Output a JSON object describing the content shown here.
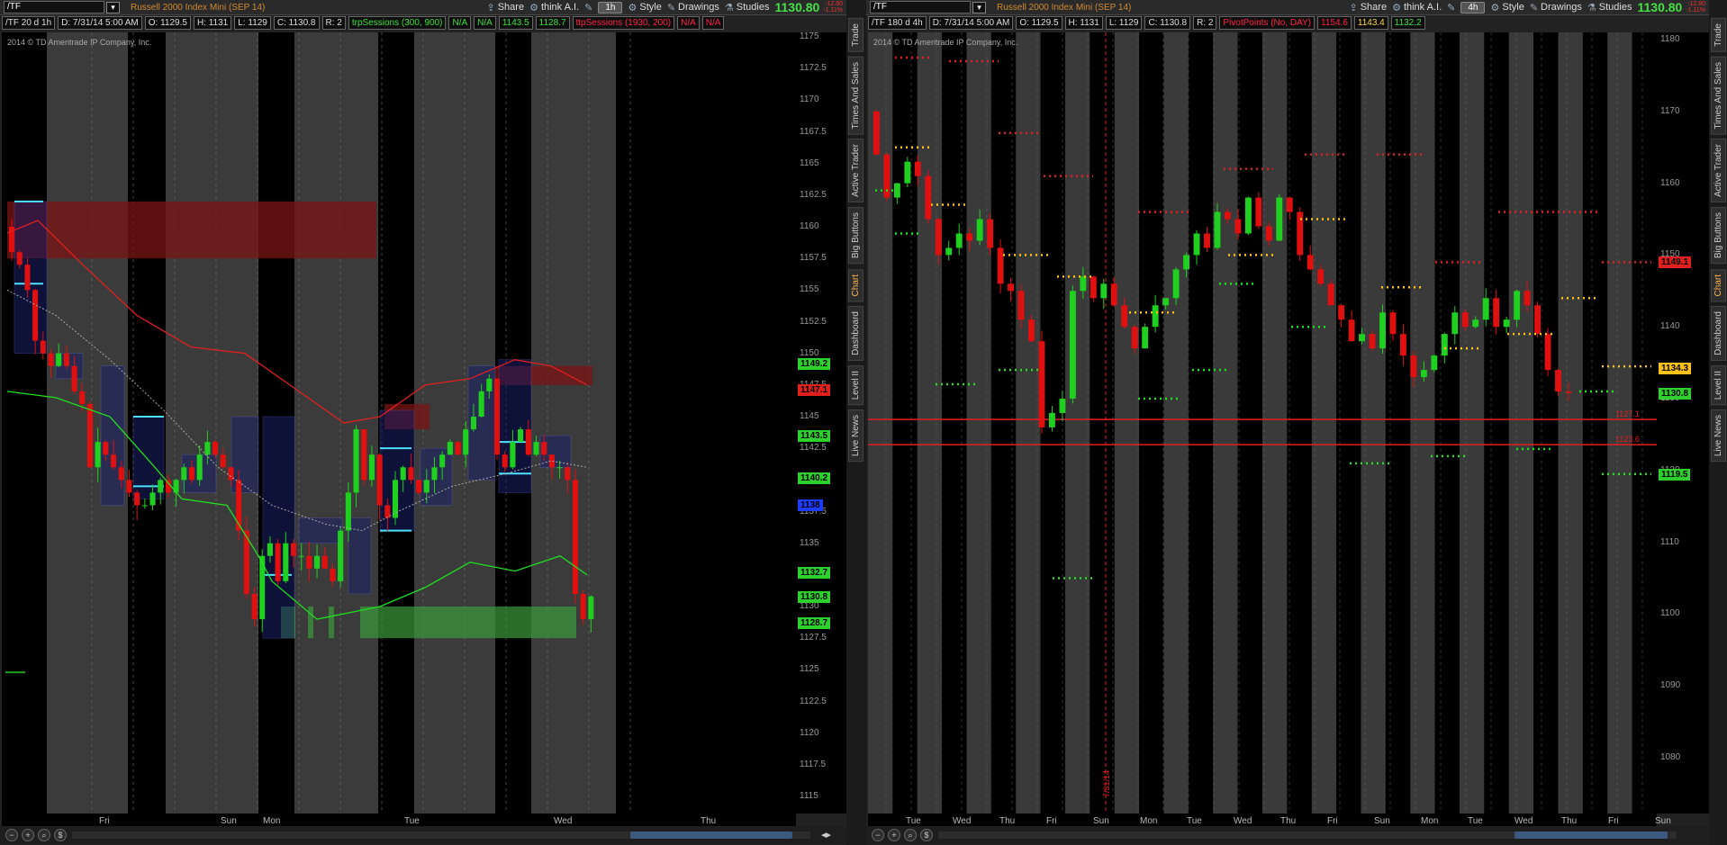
{
  "left": {
    "symbol": "/TF",
    "description": "Russell 2000 Index Mini (SEP 14)",
    "toolbar": {
      "share": "Share",
      "thinkai": "think A.I.",
      "aggregation": "1h",
      "style": "Style",
      "drawings": "Drawings",
      "studies": "Studies"
    },
    "last_price": "1130.80",
    "change1": "-12.80",
    "change2": "-1.11%",
    "info": [
      "/TF 20 d 1h",
      "D: 7/31/14 5:00 AM",
      "O: 1129.5",
      "H: 1131",
      "L: 1129",
      "C: 1130.8",
      "R: 2"
    ],
    "study1": {
      "name": "trpSessions (300, 900)",
      "vals": [
        "N/A",
        "N/A",
        "1143.5",
        "1128.7"
      ]
    },
    "study2": {
      "name": "ttpSessions (1930, 200)",
      "vals": [
        "N/A",
        "N/A"
      ]
    },
    "copyright": "2014 © TD Ameritrade IP Company, Inc.",
    "yticks": [
      "1175",
      "1172.5",
      "1170",
      "1167.5",
      "1165",
      "1162.5",
      "1160",
      "1157.5",
      "1155",
      "1152.5",
      "1150",
      "1147.5",
      "1145",
      "1142.5",
      "1140",
      "1137.5",
      "1135",
      "1132.5",
      "1130",
      "1127.5",
      "1125",
      "1122.5",
      "1120",
      "1117.5",
      "1115"
    ],
    "price_labels": [
      {
        "text": "1149.2",
        "color": "#2ed02e"
      },
      {
        "text": "1147.1",
        "color": "#e01f1f"
      },
      {
        "text": "1143.5",
        "color": "#2ed02e"
      },
      {
        "text": "1140.2",
        "color": "#2ed02e"
      },
      {
        "text": "1138",
        "color": "#1e3cff"
      },
      {
        "text": "1132.7",
        "color": "#2ed02e"
      },
      {
        "text": "1130.8",
        "color": "#2ed02e"
      },
      {
        "text": "1128.7",
        "color": "#2ed02e"
      }
    ],
    "xlabels": [
      "Fri",
      "Sun",
      "Mon",
      "Tue",
      "Wed",
      "Thu"
    ]
  },
  "right": {
    "symbol": "/TF",
    "description": "Russell 2000 Index Mini (SEP 14)",
    "toolbar": {
      "share": "Share",
      "thinkai": "think A.I.",
      "aggregation": "4h",
      "style": "Style",
      "drawings": "Drawings",
      "studies": "Studies"
    },
    "last_price": "1130.80",
    "change1": "-12.80",
    "change2": "-1.11%",
    "info": [
      "/TF 180 d 4h",
      "D: 7/31/14 5:00 AM",
      "O: 1129.5",
      "H: 1131",
      "L: 1129",
      "C: 1130.8",
      "R: 2"
    ],
    "study1": {
      "name": "PivotPoints (No, DAY)",
      "vals": [
        "1154.6",
        "1143.4",
        "1132.2"
      ]
    },
    "copyright": "2014 © TD Ameritrade IP Company, Inc.",
    "yticks": [
      "1180",
      "1170",
      "1160",
      "1150",
      "1140",
      "1130",
      "1120",
      "1110",
      "1100",
      "1090",
      "1080"
    ],
    "price_labels": [
      {
        "text": "1149.1",
        "color": "#e01f1f"
      },
      {
        "text": "1134.3",
        "color": "#ffc21a"
      },
      {
        "text": "1130.8",
        "color": "#2ed02e"
      },
      {
        "text": "1119.5",
        "color": "#2ed02e"
      }
    ],
    "line_labels": [
      "1127.1",
      "1123.6"
    ],
    "vertical_label": "7/31/14",
    "xlabels": [
      "Tue",
      "Wed",
      "Thu",
      "Fri",
      "Sun",
      "Mon",
      "Tue",
      "Wed",
      "Thu",
      "Fri",
      "Sun",
      "Mon",
      "Tue",
      "Wed",
      "Thu",
      "Fri",
      "Sun"
    ]
  },
  "sidebar_tabs": [
    "Trade",
    "Times And Sales",
    "Active Trader",
    "Big Buttons",
    "Chart",
    "Dashboard",
    "Level II",
    "Live News"
  ],
  "colors": {
    "bull": "#20d020",
    "bear": "#e01010",
    "bg": "#000000",
    "shade": "#3c3c3c"
  }
}
